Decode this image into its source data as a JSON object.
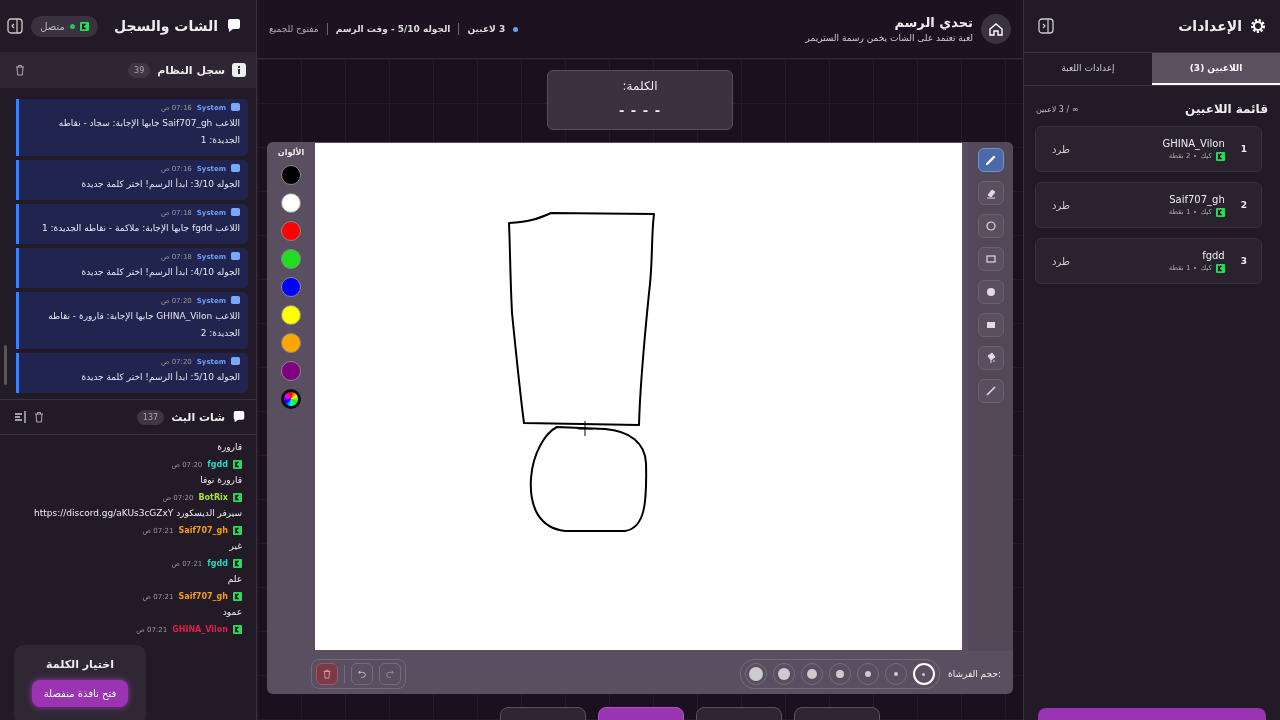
{
  "chat_panel": {
    "title": "الشات والسجل",
    "status": "متصل",
    "connected": true
  },
  "system_log": {
    "title": "سجل النظام",
    "count": "39",
    "entries": [
      {
        "sender": "System",
        "time": "07:16 ص",
        "text": "اللاعب Saif707_gh جابها الإجابة: سجاد - نقاطه الجديدة: 1"
      },
      {
        "sender": "System",
        "time": "07:16 ص",
        "text": "الجوله 3/10: ابدأ الرسم! اختر كلمة جديدة"
      },
      {
        "sender": "System",
        "time": "07:18 ص",
        "text": "اللاعب fgdd جابها الإجابة: ملاكمة - نقاطه الجديدة: 1"
      },
      {
        "sender": "System",
        "time": "07:18 ص",
        "text": "الجوله 4/10: ابدأ الرسم! اختر كلمة جديدة"
      },
      {
        "sender": "System",
        "time": "07:20 ص",
        "text": "اللاعب GHINA_Vilon جابها الإجابة: قارورة - نقاطه الجديدة: 2"
      },
      {
        "sender": "System",
        "time": "07:20 ص",
        "text": "الجوله 5/10: ابدأ الرسم! اختر كلمة جديدة"
      }
    ]
  },
  "stream_chat": {
    "title": "شات البث",
    "count": "137",
    "messages": [
      {
        "text": "قارورة"
      },
      {
        "user": "fgdd",
        "color": "#2dd4bf",
        "time": "07:20 ص",
        "text": "قارورة نوفا"
      },
      {
        "user": "BotRix",
        "color": "#a3e635",
        "time": "07:20 ص",
        "text": "سيرفر الديسكورد https://discord.gg/aKUs3cGZxY"
      },
      {
        "user": "Saif707_gh",
        "color": "#f59e0b",
        "time": "07:21 ص",
        "text": "غير"
      },
      {
        "user": "fgdd",
        "color": "#2dd4bf",
        "time": "07:21 ص",
        "text": "علم"
      },
      {
        "user": "Saif707_gh",
        "color": "#f59e0b",
        "time": "07:21 ص",
        "text": "عمود"
      },
      {
        "user": "GHINA_Vilon",
        "color": "#e11d48",
        "time": "07:21 ص"
      }
    ]
  },
  "word_popup": {
    "title": "اختيار الكلمة",
    "button": "فتح نافذة منفصلة"
  },
  "header": {
    "title": "تحدي الرسم",
    "subtitle": "لعبة تعتمد على الشات يخمن رسمة الستريمر",
    "stats": [
      "3 لاعبين",
      "الجوله 5/10 - وقت الرسم",
      "مفتوح للجميع"
    ]
  },
  "word_card": {
    "label": "الكلمة:",
    "hint": "- - - -"
  },
  "palette": {
    "title": "الألوان",
    "colors": [
      {
        "kind": "swatch",
        "color": "#000000"
      },
      {
        "kind": "swatch",
        "color": "#ffffff"
      },
      {
        "kind": "swatch",
        "color": "#ff0000"
      },
      {
        "kind": "swatch",
        "color": "#22dd22"
      },
      {
        "kind": "swatch",
        "color": "#0000ff"
      },
      {
        "kind": "swatch",
        "color": "#ffff00"
      },
      {
        "kind": "swatch",
        "color": "#ffa500"
      },
      {
        "kind": "swatch",
        "color": "#800080"
      },
      {
        "kind": "picker"
      }
    ]
  },
  "tools": [
    {
      "kind": "pen",
      "selected": true
    },
    {
      "kind": "eraser",
      "selected": false
    },
    {
      "kind": "circle",
      "selected": false
    },
    {
      "kind": "rect",
      "selected": false
    },
    {
      "kind": "filled-circle",
      "selected": false
    },
    {
      "kind": "filled-rect",
      "selected": false
    },
    {
      "kind": "fill",
      "selected": false
    },
    {
      "kind": "line",
      "selected": false
    }
  ],
  "brush": {
    "label": "حجم الفرشاة:",
    "sizes": [
      {
        "selected": false
      },
      {
        "selected": false
      },
      {
        "selected": false
      },
      {
        "selected": false
      },
      {
        "selected": false
      },
      {
        "selected": false
      },
      {
        "selected": true
      }
    ]
  },
  "bottom_buttons": [
    {
      "selected": false
    },
    {
      "selected": true
    },
    {
      "selected": false
    },
    {
      "selected": false
    }
  ],
  "settings": {
    "title": "الإعدادات",
    "tabs": [
      {
        "label": "اللاعبين (3)",
        "selected": true
      },
      {
        "label": "إعدادات اللعبة",
        "selected": false
      }
    ],
    "list_title": "قائمة اللاعبين",
    "capacity": "∞ / 3 لاعبين",
    "players": [
      {
        "rank": "1",
        "name": "GHINA_Vilon",
        "platform": "كيك",
        "points": "2 نقطة",
        "action": "طرد"
      },
      {
        "rank": "2",
        "name": "Saif707_gh",
        "platform": "كيك",
        "points": "1 نقطة",
        "action": "طرد"
      },
      {
        "rank": "3",
        "name": "fgdd",
        "platform": "كيك",
        "points": "1 نقطة",
        "action": "طرد"
      }
    ]
  }
}
